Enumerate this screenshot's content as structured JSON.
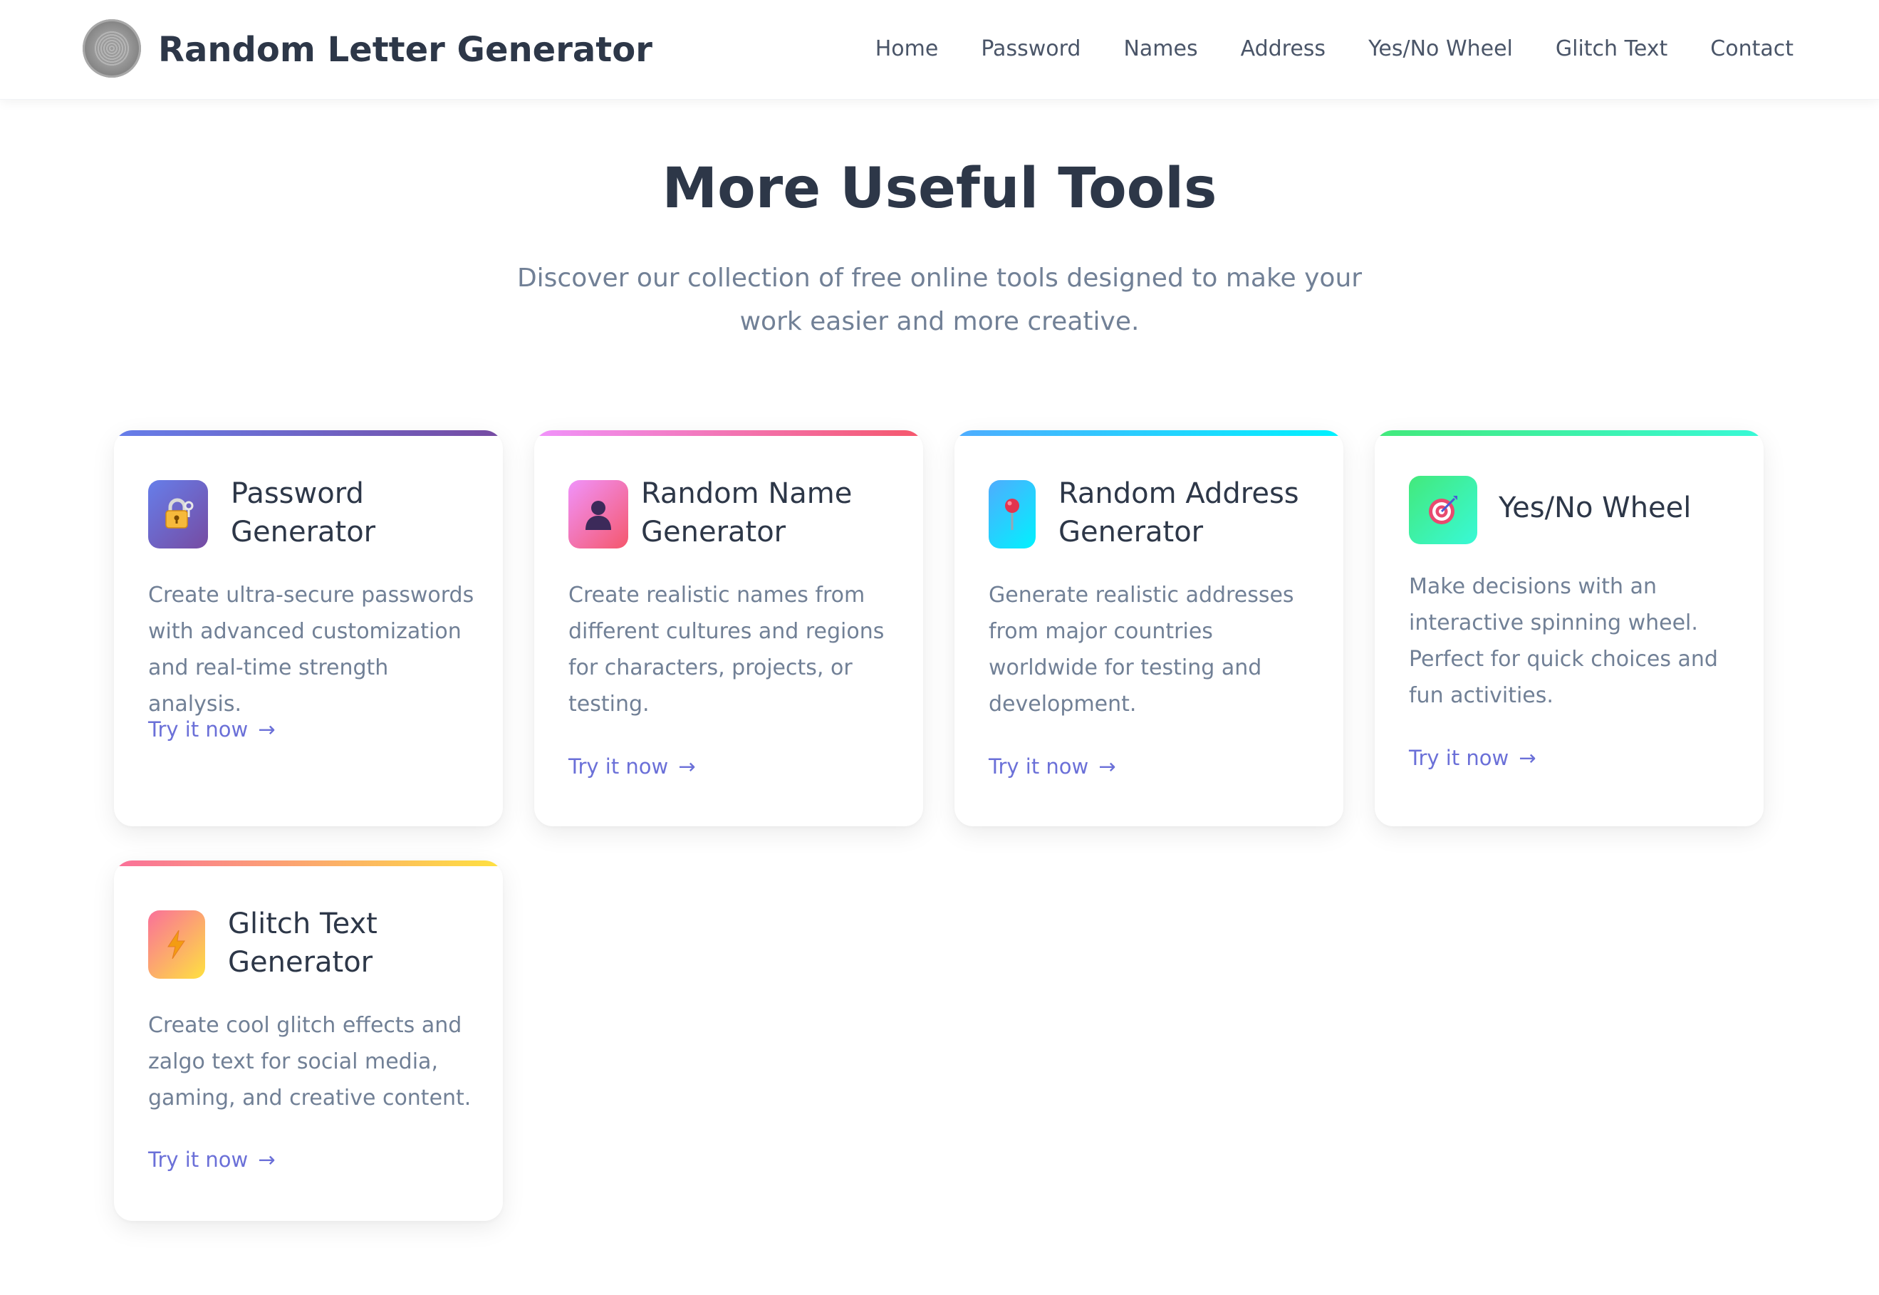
{
  "header": {
    "site_title": "Random Letter Generator",
    "nav": [
      "Home",
      "Password",
      "Names",
      "Address",
      "Yes/No Wheel",
      "Glitch Text",
      "Contact"
    ]
  },
  "section": {
    "title": "More Useful Tools",
    "subtitle": "Discover our collection of free online tools designed to make your work easier and more creative."
  },
  "cards": [
    {
      "title": "Password Generator",
      "description": "Create ultra-secure passwords with advanced customization and real-time strength analysis.",
      "link": "Try it now",
      "arrow": "→",
      "icon": "lock-key-icon",
      "gradient": [
        "#667eea",
        "#764ba2"
      ]
    },
    {
      "title": "Random Name Generator",
      "description": "Create realistic names from different cultures and regions for characters, projects, or testing.",
      "link": "Try it now",
      "arrow": "→",
      "icon": "person-silhouette-icon",
      "gradient": [
        "#f093fb",
        "#f5576c"
      ]
    },
    {
      "title": "Random Address Generator",
      "description": "Generate realistic addresses from major countries worldwide for testing and development.",
      "link": "Try it now",
      "arrow": "→",
      "icon": "map-pin-icon",
      "gradient": [
        "#4facfe",
        "#00f2fe"
      ]
    },
    {
      "title": "Yes/No Wheel",
      "description": "Make decisions with an interactive spinning wheel. Perfect for quick choices and fun activities.",
      "link": "Try it now",
      "arrow": "→",
      "icon": "target-dart-icon",
      "gradient": [
        "#43e97b",
        "#38f9d7"
      ]
    },
    {
      "title": "Glitch Text Generator",
      "description": "Create cool glitch effects and zalgo text for social media, gaming, and creative content.",
      "link": "Try it now",
      "arrow": "→",
      "icon": "lightning-bolt-icon",
      "gradient": [
        "#fa709a",
        "#fee140"
      ]
    }
  ]
}
